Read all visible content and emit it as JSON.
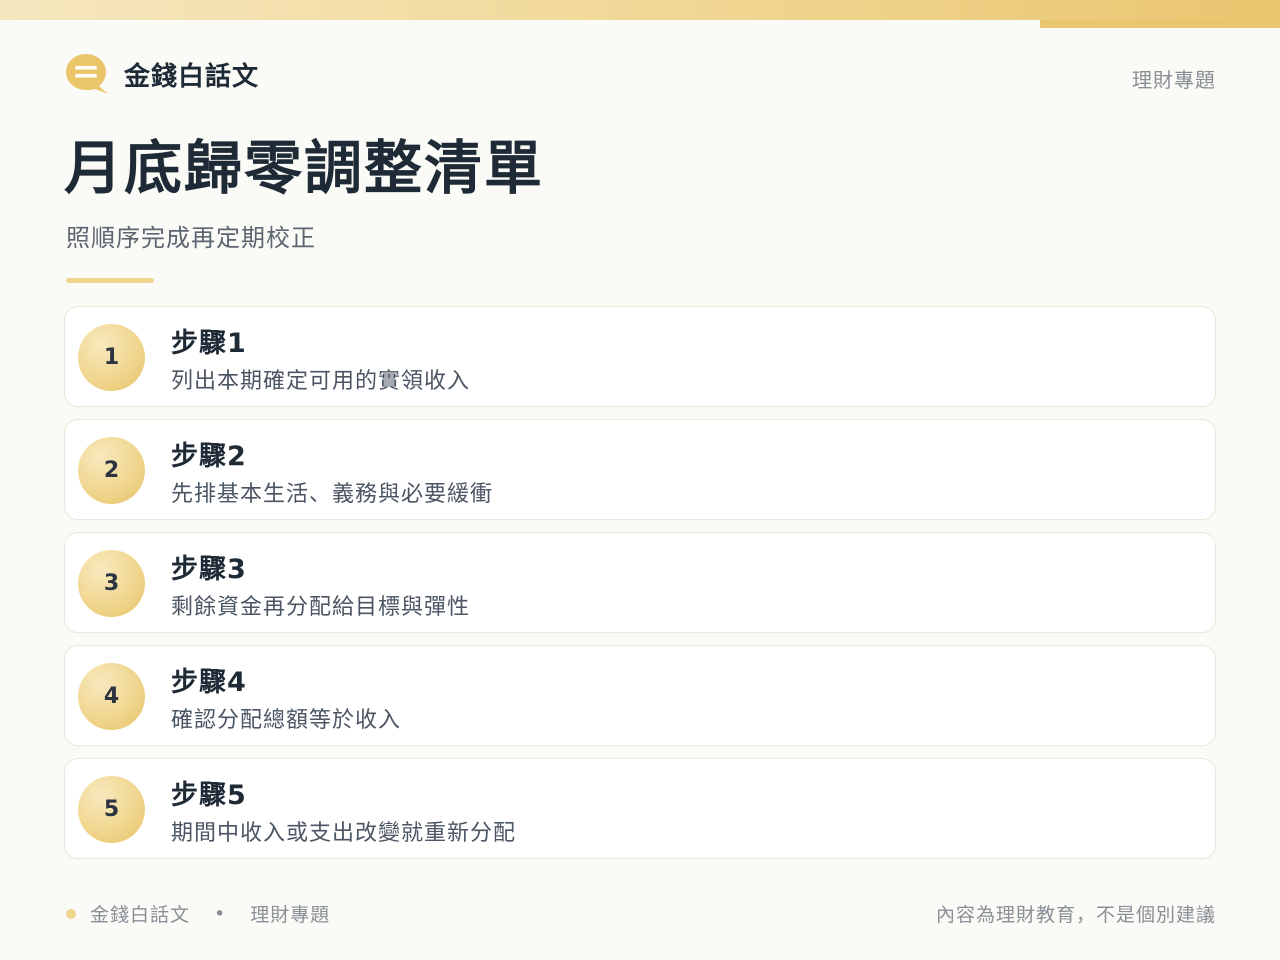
{
  "brand": {
    "name": "金錢白話文",
    "icon": "speech-bubble-icon"
  },
  "header": {
    "tag": "理財專題"
  },
  "page": {
    "title": "月底歸零調整清單",
    "subtitle": "照順序完成再定期校正"
  },
  "steps": [
    {
      "number": "1",
      "title": "步驟1",
      "description": "列出本期確定可用的實領收入"
    },
    {
      "number": "2",
      "title": "步驟2",
      "description": "先排基本生活、義務與必要緩衝"
    },
    {
      "number": "3",
      "title": "步驟3",
      "description": "剩餘資金再分配給目標與彈性"
    },
    {
      "number": "4",
      "title": "步驟4",
      "description": "確認分配總額等於收入"
    },
    {
      "number": "5",
      "title": "步驟5",
      "description": "期間中收入或支出改變就重新分配"
    }
  ],
  "footer": {
    "brand": "金錢白話文",
    "separator": "•",
    "tag": "理財專題",
    "disclaimer": "內容為理財教育，不是個別建議"
  },
  "colors": {
    "accent": "#F0D58F",
    "accent_dark": "#E9C56E",
    "text": "#1F2A37",
    "muted": "#8A8F96",
    "background": "#FAFAF7"
  }
}
